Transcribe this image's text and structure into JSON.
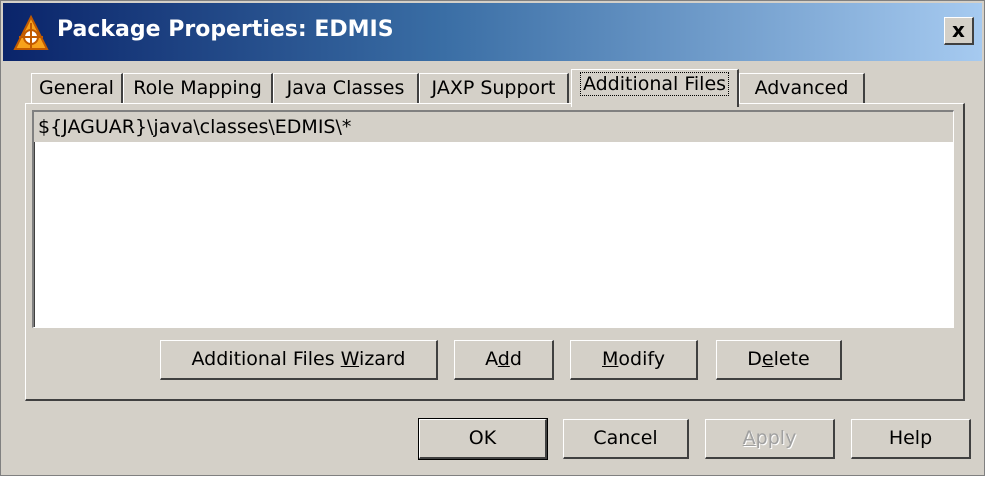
{
  "window": {
    "title": "Package Properties: EDMIS",
    "close_label": "x"
  },
  "icons": {
    "app": "package-icon",
    "close": "close-icon"
  },
  "colors": {
    "titlebar_start": "#0a246a",
    "titlebar_end": "#a6caf0",
    "face": "#d4d0c8"
  },
  "tabs": [
    {
      "label": "General",
      "selected": false
    },
    {
      "label": "Role Mapping",
      "selected": false
    },
    {
      "label": "Java Classes",
      "selected": false
    },
    {
      "label": "JAXP Support",
      "selected": false
    },
    {
      "label": "Additional Files",
      "selected": true
    },
    {
      "label": "Advanced",
      "selected": false
    }
  ],
  "file_list": {
    "items": [
      "${JAGUAR}\\java\\classes\\EDMIS\\*"
    ]
  },
  "panel_buttons": {
    "wizard": {
      "pre": "Additional Files ",
      "key": "W",
      "post": "izard"
    },
    "add": {
      "pre": "A",
      "key": "d",
      "post": "d"
    },
    "modify": {
      "pre": "",
      "key": "M",
      "post": "odify"
    },
    "delete": {
      "pre": "D",
      "key": "e",
      "post": "lete"
    }
  },
  "dialog_buttons": {
    "ok": "OK",
    "cancel": "Cancel",
    "apply": {
      "pre": "",
      "key": "A",
      "post": "pply",
      "disabled": true
    },
    "help": "Help"
  }
}
